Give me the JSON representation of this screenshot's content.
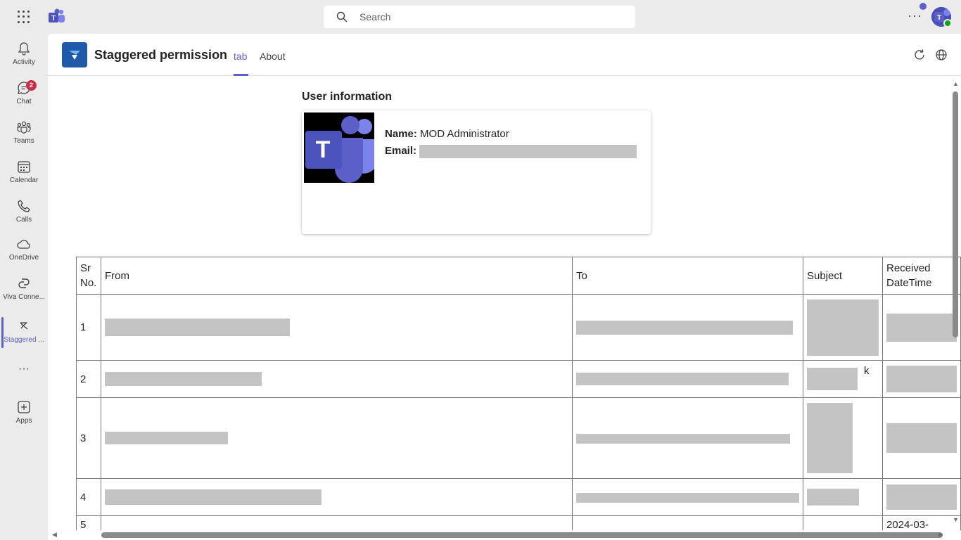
{
  "topbar": {
    "search_placeholder": "Search",
    "more_label": "···",
    "avatar_initial": "T"
  },
  "rail": {
    "items": [
      {
        "label": "Activity",
        "icon": "bell-icon"
      },
      {
        "label": "Chat",
        "icon": "chat-icon",
        "badge": "2"
      },
      {
        "label": "Teams",
        "icon": "teams-icon"
      },
      {
        "label": "Calendar",
        "icon": "calendar-icon"
      },
      {
        "label": "Calls",
        "icon": "phone-icon"
      },
      {
        "label": "OneDrive",
        "icon": "cloud-icon"
      },
      {
        "label": "Viva Conne...",
        "icon": "viva-connections-icon"
      },
      {
        "label": "Staggered ...",
        "icon": "staggered-app-icon"
      },
      {
        "label": "···",
        "icon": "more-icon"
      },
      {
        "label": "Apps",
        "icon": "apps-add-icon"
      }
    ]
  },
  "app": {
    "title": "Staggered permission",
    "tabs": [
      {
        "label": "tab",
        "active": true
      },
      {
        "label": "About",
        "active": false
      }
    ]
  },
  "user_info": {
    "heading": "User information",
    "name_label": "Name:",
    "name_value": "MOD Administrator",
    "email_label": "Email:",
    "photo_initial": "T"
  },
  "mail_table": {
    "headers": [
      "Sr No.",
      "From",
      "To",
      "Subject",
      "Received DateTime"
    ],
    "rows": [
      {
        "sr": "1"
      },
      {
        "sr": "2",
        "subject_fragment": "k"
      },
      {
        "sr": "3"
      },
      {
        "sr": "4"
      },
      {
        "sr": "5",
        "received_fragment": "2024-03-"
      }
    ]
  },
  "colors": {
    "accent": "#5b5fc7",
    "badge": "#c4314b",
    "presence": "#13a10e",
    "app_icon": "#1e5aa8",
    "redaction": "#c4c4c4"
  }
}
